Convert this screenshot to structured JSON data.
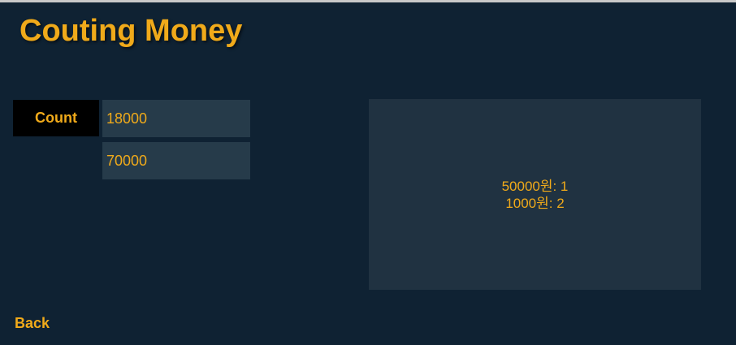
{
  "header": {
    "title": "Couting Money"
  },
  "form": {
    "count_label": "Count",
    "field_1_value": "18000",
    "field_2_value": "70000"
  },
  "result": {
    "lines": [
      "50000원: 1",
      "1000원: 2"
    ]
  },
  "footer": {
    "back_label": "Back"
  },
  "colors": {
    "background": "#0f2233",
    "accent": "#f0aa1a",
    "field_background": "#263b4a",
    "panel_background": "#203241",
    "button_background": "#000000"
  }
}
